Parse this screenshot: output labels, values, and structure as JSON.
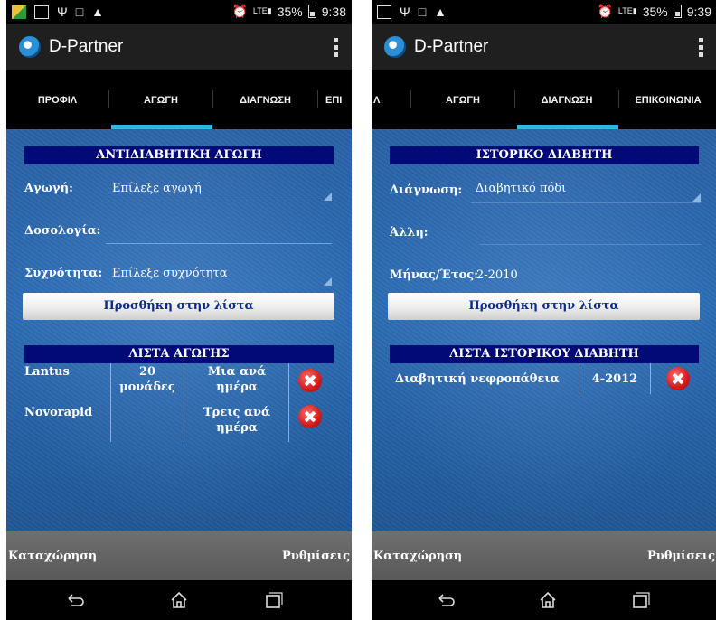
{
  "left": {
    "status": {
      "network": "LTE",
      "battery": "35%",
      "time": "9:38"
    },
    "app_title": "D-Partner",
    "tabs": [
      "ΠΡΟΦΙΛ",
      "ΑΓΩΓΗ",
      "ΔΙΑΓΝΩΣΗ",
      "ΕΠΙ"
    ],
    "selected_tab": "ΑΓΩΓΗ",
    "section_title": "ΑΝΤΙΔΙΑΒΗΤΙΚΗ ΑΓΩΓΗ",
    "treatment_label": "Αγωγή:",
    "treatment_value": "Επίλεξε αγωγή",
    "dosage_label": "Δοσολογία:",
    "dosage_value": "",
    "frequency_label": "Συχνότητα:",
    "frequency_value": "Επίλεξε συχνότητα",
    "add_button": "Προσθήκη στην λίστα",
    "list_title": "ΛΙΣΤΑ ΑΓΩΓΗΣ",
    "rows": [
      {
        "drug": "Lantus",
        "dose": "20 μονάδες",
        "freq": "Μια ανά ημέρα"
      },
      {
        "drug": "Novorapid",
        "dose": "",
        "freq": "Τρεις ανά ημέρα"
      }
    ],
    "bottom_left": "Καταχώρηση",
    "bottom_right": "Ρυθμίσεις"
  },
  "right": {
    "status": {
      "network": "LTE",
      "battery": "35%",
      "time": "9:39"
    },
    "app_title": "D-Partner",
    "tabs": [
      "Λ",
      "ΑΓΩΓΗ",
      "ΔΙΑΓΝΩΣΗ",
      "ΕΠΙΚΟΙΝΩΝΙΑ"
    ],
    "selected_tab": "ΔΙΑΓΝΩΣΗ",
    "section_title": "ΙΣΤΟΡΙΚΟ ΔΙΑΒΗΤΗ",
    "diagnosis_label": "Διάγνωση:",
    "diagnosis_value": "Διαβητικό πόδι",
    "other_label": "Άλλη:",
    "other_value": "",
    "date_label": "Μήνας/Έτος:",
    "date_value": "2-2010",
    "add_button": "Προσθήκη στην λίστα",
    "list_title": "ΛΙΣΤΑ ΙΣΤΟΡΙΚΟΥ ΔΙΑΒΗΤΗ",
    "rows": [
      {
        "condition": "Διαβητική νεφροπάθεια",
        "date": "4-2012"
      }
    ],
    "bottom_left": "Καταχώρηση",
    "bottom_right": "Ρυθμίσεις"
  },
  "colors": {
    "tab_indicator": "#33b5e5",
    "section_header": "#020a78",
    "content_blue": "#2c6db5",
    "delete_red": "#d21a1a"
  }
}
